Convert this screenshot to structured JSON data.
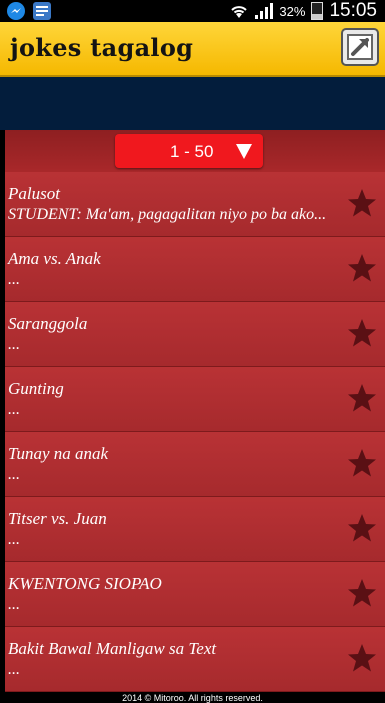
{
  "status_bar": {
    "battery": "32%",
    "battery_level": 0.32,
    "time": "15:05",
    "icons": [
      "messenger-icon",
      "notification-app-icon",
      "wifi-icon",
      "signal-icon",
      "battery-icon"
    ]
  },
  "action_bar": {
    "title": "jokes tagalog",
    "share_icon": "share-icon",
    "bg_color": "#f5c21a"
  },
  "page_selector": {
    "label": "1 - 50",
    "icon": "dropdown-triangle-icon"
  },
  "items": [
    {
      "title": "Palusot",
      "subtitle": "STUDENT: Ma'am, pagagalitan niyo po ba ako..."
    },
    {
      "title": "Ama vs. Anak",
      "subtitle": "..."
    },
    {
      "title": "Saranggola",
      "subtitle": "..."
    },
    {
      "title": "Gunting",
      "subtitle": "..."
    },
    {
      "title": "Tunay na anak",
      "subtitle": "..."
    },
    {
      "title": "Titser vs. Juan",
      "subtitle": "..."
    },
    {
      "title": "KWENTONG SIOPAO",
      "subtitle": "..."
    },
    {
      "title": "Bakit Bawal Manligaw sa Text",
      "subtitle": "..."
    }
  ],
  "footer": "2014 © Mitoroo. All rights reserved.",
  "colors": {
    "accent_yellow": "#f5c21a",
    "list_red": "#b02d30",
    "selector_red": "#f0181e",
    "star": "#5a1014"
  }
}
